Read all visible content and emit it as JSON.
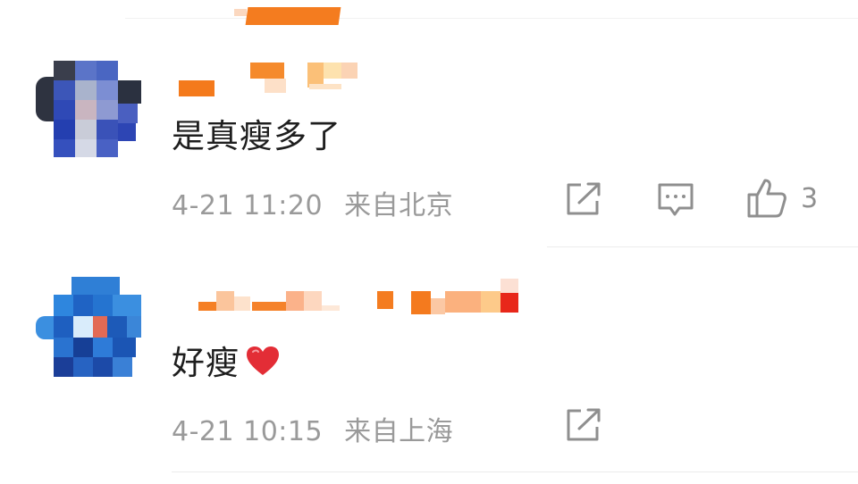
{
  "comments": [
    {
      "text": "是真瘦多了",
      "date": "4-21 11:20",
      "location": "来自北京",
      "like_count": "3",
      "actions": [
        "share-icon",
        "reply-icon",
        "like-icon"
      ]
    },
    {
      "text": "好瘦",
      "emoji": "heart-emoji",
      "date": "4-21 10:15",
      "location": "来自上海",
      "actions": [
        "share-icon"
      ]
    }
  ],
  "colors": {
    "username_mosaic": "#f07a1e",
    "meta_text": "#9a9a9a",
    "heart": "#e32d36"
  }
}
